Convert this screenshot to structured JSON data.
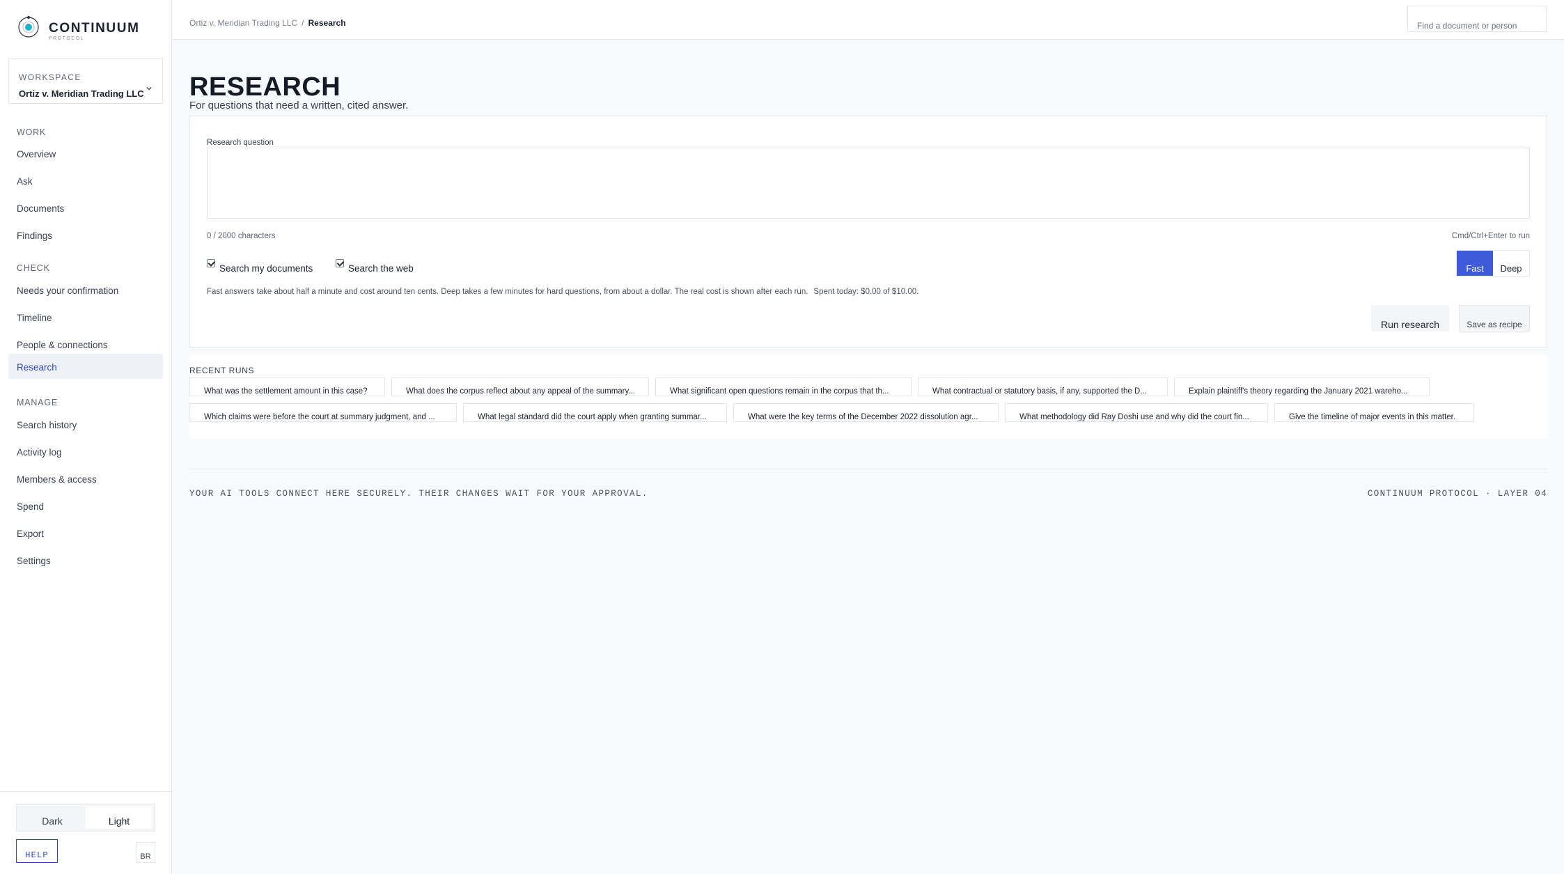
{
  "brand": {
    "name": "CONTINUUM",
    "sub": "PROTOCOL"
  },
  "workspace": {
    "label": "WORKSPACE",
    "name": "Ortiz v. Meridian Trading LLC"
  },
  "nav": {
    "work_label": "WORK",
    "work_items": [
      "Overview",
      "Ask",
      "Documents",
      "Findings"
    ],
    "check_label": "CHECK",
    "check_items": [
      "Needs your confirmation",
      "Timeline",
      "People & connections",
      "Research"
    ],
    "manage_label": "MANAGE",
    "manage_items": [
      "Search history",
      "Activity log",
      "Members & access",
      "Spend",
      "Export",
      "Settings"
    ],
    "active": "Research"
  },
  "theme": {
    "dark": "Dark",
    "light": "Light",
    "selected": "Light"
  },
  "help_label": "HELP",
  "lang_label": "BR",
  "breadcrumb": {
    "parent": "Ortiz v. Meridian Trading LLC",
    "separator": "/",
    "current": "Research"
  },
  "search": {
    "placeholder": "Find a document or person"
  },
  "page": {
    "title": "RESEARCH",
    "subtitle": "For questions that need a written, cited answer."
  },
  "form": {
    "question_label": "Research question",
    "question_value": "",
    "char_count": "0 / 2000 characters",
    "shortcut": "Cmd/Ctrl+Enter to run",
    "search_docs_label": "Search my documents",
    "search_docs_checked": true,
    "search_web_label": "Search the web",
    "search_web_checked": true,
    "mode_fast": "Fast",
    "mode_deep": "Deep",
    "mode_selected": "Fast",
    "hint": "Fast answers take about half a minute and cost around ten cents. Deep takes a few minutes for hard questions, from about a dollar. The real cost is shown after each run.",
    "spent": "Spent today: $0.00 of $10.00.",
    "run_label": "Run research",
    "save_label": "Save as recipe"
  },
  "recent": {
    "label": "RECENT RUNS",
    "runs": [
      "What was the settlement amount in this case?",
      "What does the corpus reflect about any appeal of the summary...",
      "What significant open questions remain in the corpus that th...",
      "What contractual or statutory basis, if any, supported the D...",
      "Explain plaintiff's theory regarding the January 2021 wareho...",
      "Which claims were before the court at summary judgment, and ...",
      "What legal standard did the court apply when granting summar...",
      "What were the key terms of the December 2022 dissolution agr...",
      "What methodology did Ray Doshi use and why did the court fin...",
      "Give the timeline of major events in this matter."
    ]
  },
  "footer": {
    "left": "YOUR AI TOOLS CONNECT HERE SECURELY. THEIR CHANGES WAIT FOR YOUR APPROVAL.",
    "right": "CONTINUUM PROTOCOL · LAYER 04"
  },
  "colors": {
    "accent": "#3d5bd9",
    "active_nav_text": "#2d49b8",
    "active_nav_bg": "#eef1f7"
  }
}
